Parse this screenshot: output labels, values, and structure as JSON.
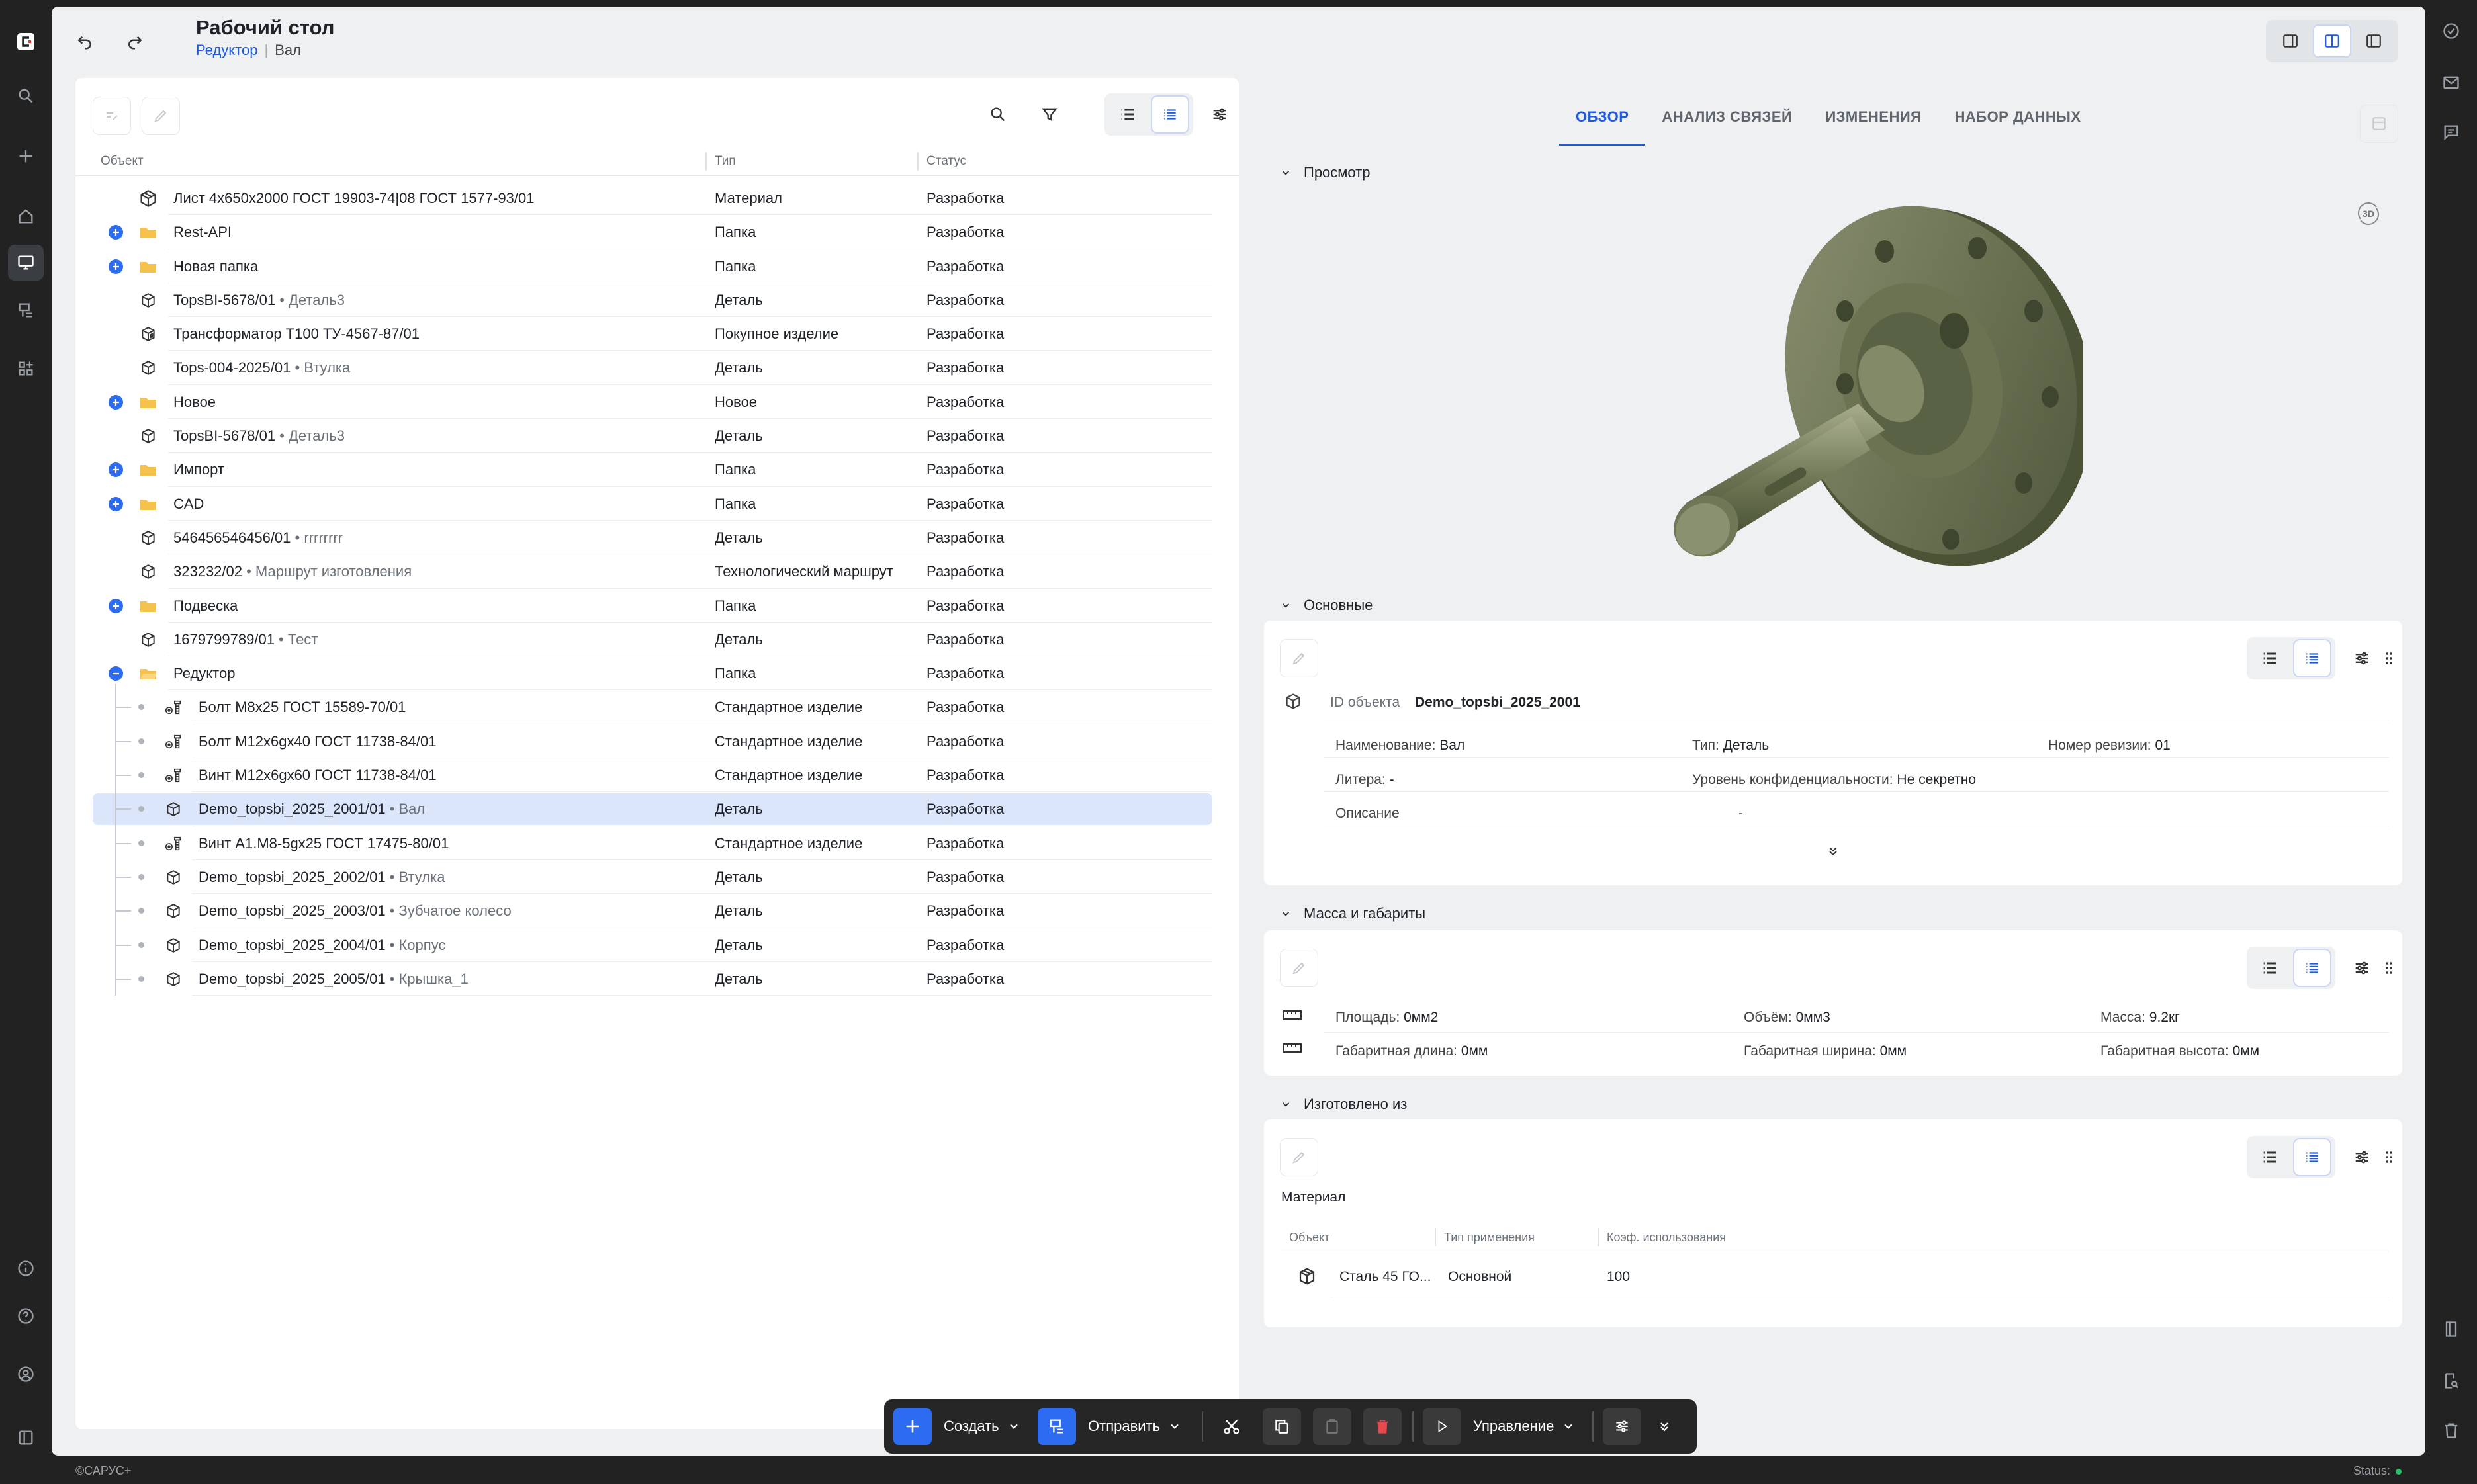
{
  "header": {
    "title": "Рабочий стол",
    "breadcrumb": [
      "Редуктор",
      "Вал"
    ]
  },
  "toolbar": {
    "icons": [
      "undo-icon",
      "redo-icon"
    ]
  },
  "table": {
    "columns": [
      "Объект",
      "Тип",
      "Статус"
    ],
    "rows": [
      {
        "name": "Лист 4х650х2000 ГОСТ 19903-74|08 ГОСТ 1577-93/01",
        "sub": "",
        "type": "Материал",
        "status": "Разработка",
        "icon": "material",
        "toggle": ""
      },
      {
        "name": "Rest-API",
        "sub": "",
        "type": "Папка",
        "status": "Разработка",
        "icon": "folder",
        "toggle": "+"
      },
      {
        "name": "Новая папка",
        "sub": "",
        "type": "Папка",
        "status": "Разработка",
        "icon": "folder",
        "toggle": "+"
      },
      {
        "name": "TopsBI-5678/01",
        "sub": "• Деталь3",
        "type": "Деталь",
        "status": "Разработка",
        "icon": "part",
        "toggle": ""
      },
      {
        "name": "Трансформатор Т100 ТУ-4567-87/01",
        "sub": "",
        "type": "Покупное изделие",
        "status": "Разработка",
        "icon": "purchased",
        "toggle": ""
      },
      {
        "name": "Tops-004-2025/01",
        "sub": "• Втулка",
        "type": "Деталь",
        "status": "Разработка",
        "icon": "part",
        "toggle": ""
      },
      {
        "name": "Новое",
        "sub": "",
        "type": "Новое",
        "status": "Разработка",
        "icon": "folder",
        "toggle": "+"
      },
      {
        "name": "TopsBI-5678/01",
        "sub": "• Деталь3",
        "type": "Деталь",
        "status": "Разработка",
        "icon": "part",
        "toggle": ""
      },
      {
        "name": "Импорт",
        "sub": "",
        "type": "Папка",
        "status": "Разработка",
        "icon": "folder",
        "toggle": "+"
      },
      {
        "name": "CAD",
        "sub": "",
        "type": "Папка",
        "status": "Разработка",
        "icon": "folder",
        "toggle": "+"
      },
      {
        "name": "546456546456/01",
        "sub": "• rrrrrrrr",
        "type": "Деталь",
        "status": "Разработка",
        "icon": "part",
        "toggle": ""
      },
      {
        "name": "323232/02",
        "sub": "• Маршрут изготовления",
        "type": "Технологический маршрут",
        "status": "Разработка",
        "icon": "part",
        "toggle": ""
      },
      {
        "name": "Подвеска",
        "sub": "",
        "type": "Папка",
        "status": "Разработка",
        "icon": "folder",
        "toggle": "+"
      },
      {
        "name": "1679799789/01",
        "sub": "• Тест",
        "type": "Деталь",
        "status": "Разработка",
        "icon": "part",
        "toggle": ""
      },
      {
        "name": "Редуктор",
        "sub": "",
        "type": "Папка",
        "status": "Разработка",
        "icon": "folder-open",
        "toggle": "-"
      },
      {
        "name": "Болт М8х25 ГОСТ 15589-70/01",
        "sub": "",
        "type": "Стандартное изделие",
        "status": "Разработка",
        "icon": "standard",
        "child": true
      },
      {
        "name": "Болт М12х6gх40 ГОСТ 11738-84/01",
        "sub": "",
        "type": "Стандартное изделие",
        "status": "Разработка",
        "icon": "standard",
        "child": true
      },
      {
        "name": "Винт М12х6gх60 ГОСТ 11738-84/01",
        "sub": "",
        "type": "Стандартное изделие",
        "status": "Разработка",
        "icon": "standard",
        "child": true
      },
      {
        "name": "Demo_topsbi_2025_2001/01",
        "sub": "• Вал",
        "type": "Деталь",
        "status": "Разработка",
        "icon": "part",
        "child": true,
        "selected": true
      },
      {
        "name": "Винт А1.М8-5gх25 ГОСТ 17475-80/01",
        "sub": "",
        "type": "Стандартное изделие",
        "status": "Разработка",
        "icon": "standard",
        "child": true
      },
      {
        "name": "Demo_topsbi_2025_2002/01",
        "sub": "• Втулка",
        "type": "Деталь",
        "status": "Разработка",
        "icon": "part",
        "child": true
      },
      {
        "name": "Demo_topsbi_2025_2003/01",
        "sub": "• Зубчатое колесо",
        "type": "Деталь",
        "status": "Разработка",
        "icon": "part",
        "child": true
      },
      {
        "name": "Demo_topsbi_2025_2004/01",
        "sub": "• Корпус",
        "type": "Деталь",
        "status": "Разработка",
        "icon": "part",
        "child": true
      },
      {
        "name": "Demo_topsbi_2025_2005/01",
        "sub": "• Крышка_1",
        "type": "Деталь",
        "status": "Разработка",
        "icon": "part",
        "child": true
      }
    ]
  },
  "tabs": [
    "ОБЗОР",
    "АНАЛИЗ СВЯЗЕЙ",
    "ИЗМЕНЕНИЯ",
    "НАБОР ДАННЫХ"
  ],
  "sections": {
    "preview": "Просмотр",
    "viewer_badge": "3D",
    "main": {
      "title": "Основные",
      "id_label": "ID объекта",
      "id_value": "Demo_topsbi_2025_2001",
      "fields": {
        "name_label": "Наименование:",
        "name_value": "Вал",
        "type_label": "Тип:",
        "type_value": "Деталь",
        "rev_label": "Номер ревизии:",
        "rev_value": "01",
        "lit_label": "Литера:",
        "lit_value": "-",
        "conf_label": "Уровень конфиденциальности:",
        "conf_value": "Не секретно",
        "desc_label": "Описание",
        "desc_value": "-"
      }
    },
    "mass": {
      "title": "Масса и габариты",
      "area": "Площадь:",
      "area_v": "0мм2",
      "vol": "Объём:",
      "vol_v": "0мм3",
      "mass": "Масса:",
      "mass_v": "9.2кг",
      "len": "Габаритная длина:",
      "len_v": "0мм",
      "wid": "Габаритная ширина:",
      "wid_v": "0мм",
      "hgt": "Габаритная высота:",
      "hgt_v": "0мм"
    },
    "made": {
      "title": "Изготовлено из",
      "group": "Материал",
      "columns": [
        "Объект",
        "Тип применения",
        "Коэф. использования"
      ],
      "row": {
        "obj": "Сталь 45 ГО...",
        "app": "Основной",
        "coef": "100"
      }
    }
  },
  "bottom": {
    "create": "Создать",
    "send": "Отправить",
    "manage": "Управление"
  },
  "footer": {
    "copy": "©САРУС+",
    "status": "Status:"
  },
  "colors": {
    "accent": "#2d6bf0",
    "selected_row": "#dce6fb",
    "folder": "#f5c24e",
    "model": "#6b7555"
  }
}
